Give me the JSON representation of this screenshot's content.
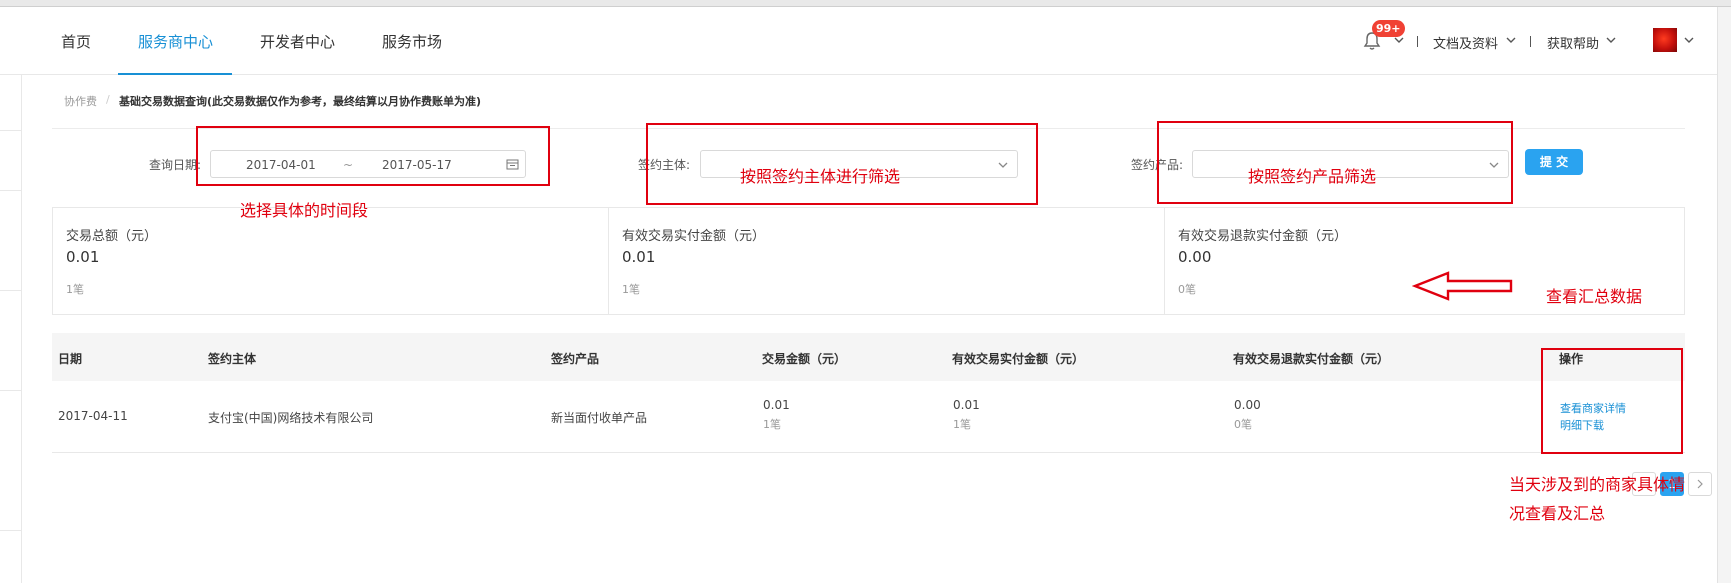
{
  "nav": {
    "items": [
      "首页",
      "服务商中心",
      "开发者中心",
      "服务市场"
    ],
    "active_index": 1,
    "notification_badge": "99+",
    "docs_label": "文档及资料",
    "help_label": "获取帮助"
  },
  "breadcrumb": {
    "parent": "协作费",
    "separator": "/",
    "current": "基础交易数据查询(此交易数据仅作为参考，最终结算以月协作费账单为准)"
  },
  "filters": {
    "date_label": "查询日期:",
    "date_start": "2017-04-01",
    "date_tilde": "~",
    "date_end": "2017-05-17",
    "entity_label": "签约主体:",
    "product_label": "签约产品:",
    "submit_label": "提 交"
  },
  "summary": [
    {
      "label": "交易总额（元）",
      "value": "0.01",
      "count": "1笔"
    },
    {
      "label": "有效交易实付金额（元）",
      "value": "0.01",
      "count": "1笔"
    },
    {
      "label": "有效交易退款实付金额（元）",
      "value": "0.00",
      "count": "0笔"
    }
  ],
  "table": {
    "headers": [
      "日期",
      "签约主体",
      "签约产品",
      "交易金额（元）",
      "有效交易实付金额（元）",
      "有效交易退款实付金额（元）",
      "操作"
    ],
    "rows": [
      {
        "date": "2017-04-11",
        "entity": "支付宝(中国)网络技术有限公司",
        "product": "新当面付收单产品",
        "amount": "0.01",
        "amount_count": "1笔",
        "paid": "0.01",
        "paid_count": "1笔",
        "refund": "0.00",
        "refund_count": "0笔",
        "action_detail": "查看商家详情",
        "action_download": "明细下载"
      }
    ]
  },
  "pagination": {
    "current_page": "1"
  },
  "annotations": {
    "date": "选择具体的时间段",
    "entity": "按照签约主体进行筛选",
    "product": "按照签约产品筛选",
    "summary": "查看汇总数据",
    "action_line1": "当天涉及到的商家具体情",
    "action_line2": "况查看及汇总"
  },
  "colors": {
    "accent": "#1890d5",
    "button": "#2aa3f0",
    "annotation": "#e0000f",
    "badge": "#f04134"
  }
}
